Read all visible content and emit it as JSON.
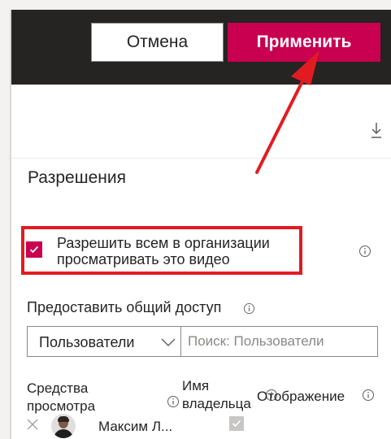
{
  "toolbar": {
    "cancel_label": "Отмена",
    "apply_label": "Применить"
  },
  "permissions": {
    "title": "Разрешения",
    "allow_org_label": "Разрешить всем в организации просматривать это видео",
    "allow_org_checked": true
  },
  "share": {
    "label": "Предоставить общий доступ",
    "dropdown_value": "Пользователи",
    "search_placeholder": "Поиск: Пользователи"
  },
  "table": {
    "headers": {
      "viewers": "Средства просмотра",
      "owner": "Имя владельца",
      "display": "Отображение"
    },
    "rows": [
      {
        "name": "Максим Л...",
        "owner_checked": true
      }
    ]
  },
  "icons": [
    "download-icon",
    "info-icon",
    "chevron-down-icon",
    "close-icon",
    "checkmark-icon"
  ],
  "colors": {
    "accent": "#c8004f",
    "header_bg": "#252423",
    "highlight": "#e21b22"
  }
}
